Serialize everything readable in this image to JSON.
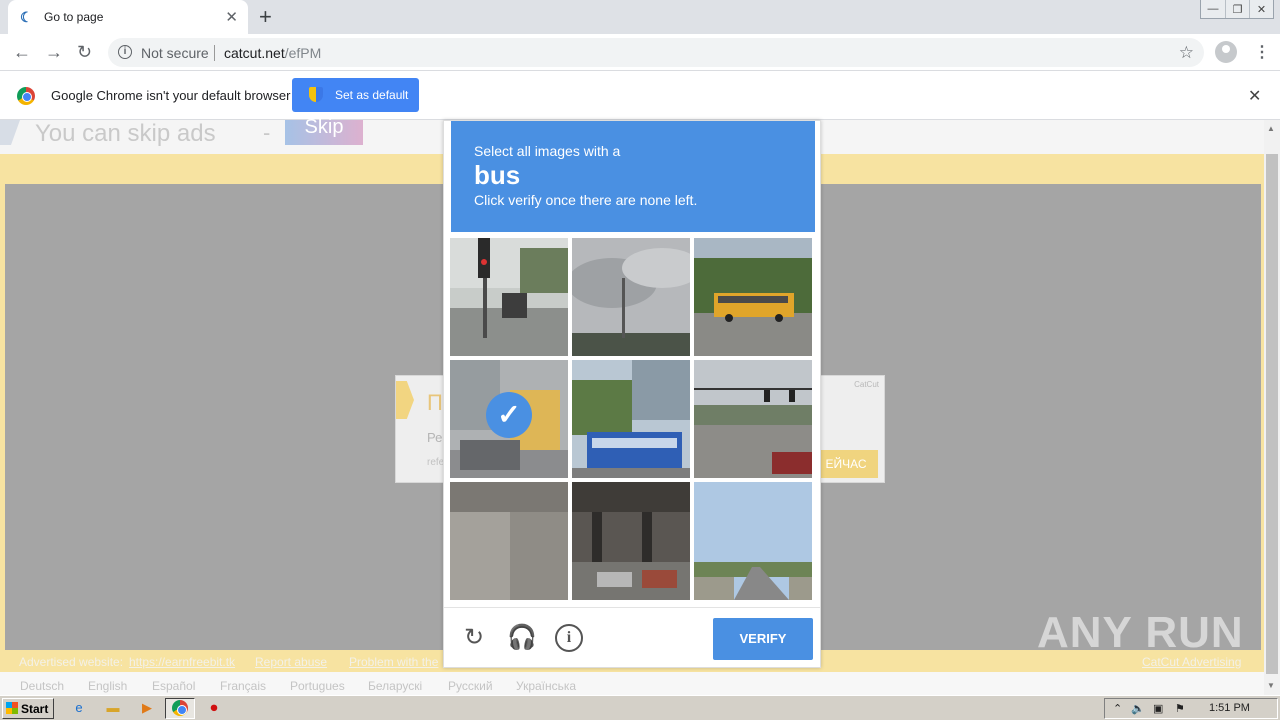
{
  "browser": {
    "tab_title": "Go to page",
    "new_tab": "+",
    "tab_close": "✕",
    "url_security": "Not secure",
    "url_host": "catcut.net",
    "url_path": "/efPM",
    "window_controls": [
      "—",
      "❐",
      "✕"
    ]
  },
  "infobar": {
    "message": "Google Chrome isn't your default browser",
    "button_label": "Set as default",
    "close": "✕"
  },
  "page": {
    "skip_text": "You can skip ads",
    "skip_dash": "-",
    "skip_button": "Skip",
    "ad": {
      "title": "П",
      "subtitle": "Ре",
      "ref": "refe",
      "brand": "CatCut",
      "cta": "ЕЙЧАС"
    },
    "footer": {
      "advertised_label": "Advertised website:",
      "advertised_link": "https://earnfreebit.tk",
      "report": "Report abuse",
      "problem": "Problem with the",
      "right_link": "CatCut Advertising"
    },
    "languages": [
      "Deutsch",
      "English",
      "Español",
      "Français",
      "Portugues",
      "Беларускі",
      "Русский",
      "Українська"
    ]
  },
  "captcha": {
    "line1": "Select all images with a",
    "target": "bus",
    "line3": "Click verify once there are none left.",
    "verify_label": "VERIFY",
    "tiles": [
      {
        "name": "traffic light intersection",
        "selected": false
      },
      {
        "name": "cloudy sky pole",
        "selected": false
      },
      {
        "name": "yellow school bus",
        "selected": false
      },
      {
        "name": "school bus street",
        "selected": true
      },
      {
        "name": "blue trolley bus",
        "selected": false
      },
      {
        "name": "highway traffic light",
        "selected": false
      },
      {
        "name": "concrete wall",
        "selected": false
      },
      {
        "name": "parking under bridge",
        "selected": false
      },
      {
        "name": "road horizon",
        "selected": false
      }
    ],
    "check_glyph": "✓",
    "reload_glyph": "↻",
    "audio_glyph": "🎧",
    "info_glyph": "i"
  },
  "watermark": "ANY RUN",
  "taskbar": {
    "start_label": "Start",
    "clock": "1:51 PM"
  }
}
